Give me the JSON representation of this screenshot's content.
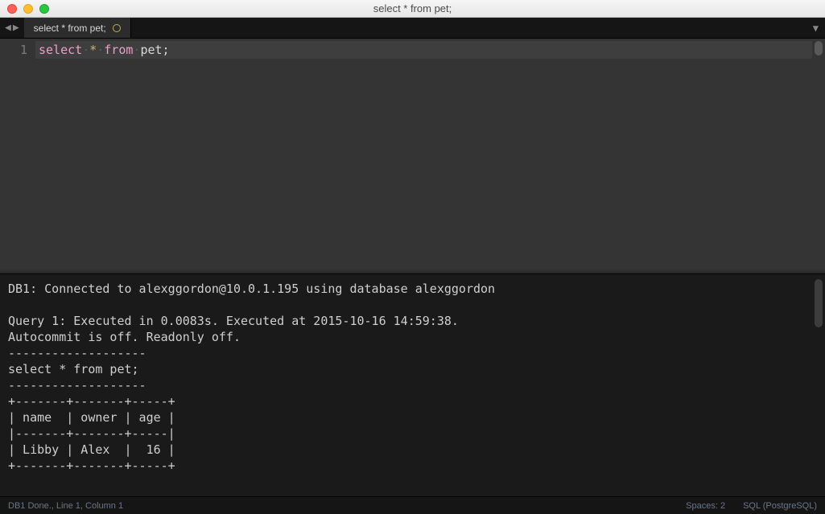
{
  "window": {
    "title": "select * from pet;"
  },
  "tabs": {
    "active": {
      "label": "select * from pet;"
    }
  },
  "editor": {
    "line_number": "1",
    "tokens": {
      "kw_select": "select",
      "star": "*",
      "kw_from": "from",
      "ident_table": "pet",
      "semicolon": ";"
    }
  },
  "console": {
    "conn_line": "DB1: Connected to alexggordon@10.0.1.195 using database alexggordon",
    "blank": "",
    "query_line": "Query 1: Executed in 0.0083s. Executed at 2015-10-16 14:59:38.",
    "autocommit_line": "Autocommit is off. Readonly off.",
    "rule_short": "-------------------",
    "echo_query": "select * from pet;",
    "rule_short2": "-------------------",
    "table_border": "+-------+-------+-----+",
    "table_header": "| name  | owner | age |",
    "table_divider": "|-------+-------+-----|",
    "table_row1": "| Libby | Alex  |  16 |",
    "table_border2": "+-------+-------+-----+"
  },
  "chart_data": {
    "type": "table",
    "title": "select * from pet;",
    "columns": [
      "name",
      "owner",
      "age"
    ],
    "rows": [
      {
        "name": "Libby",
        "owner": "Alex",
        "age": 16
      }
    ]
  },
  "status": {
    "left": "DB1 Done., Line 1, Column 1",
    "spaces": "Spaces: 2",
    "syntax": "SQL (PostgreSQL)"
  }
}
